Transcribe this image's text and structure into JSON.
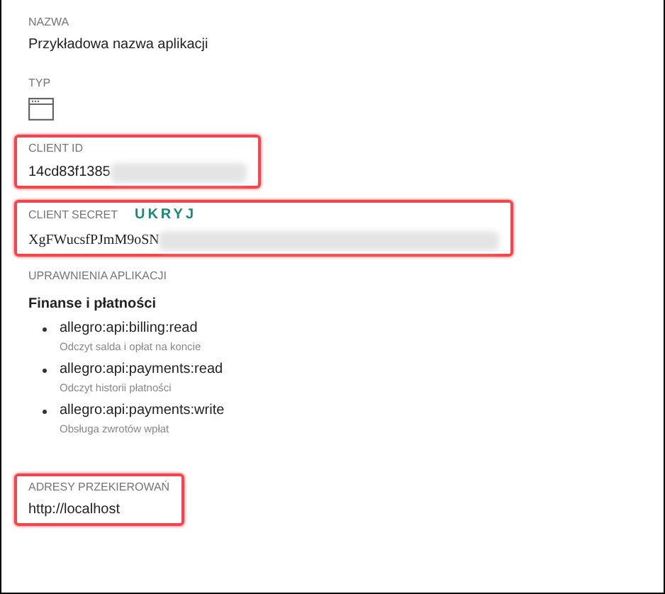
{
  "sections": [
    {
      "kind": "text",
      "label": "NAZWA",
      "value": "Przykładowa nazwa aplikacji",
      "highlighted": false
    },
    {
      "kind": "icon",
      "label": "TYP",
      "highlighted": false
    },
    {
      "kind": "secret",
      "label": "CLIENT ID",
      "value": "14cd83f1385",
      "highlighted": true
    },
    {
      "kind": "secret",
      "label": "CLIENT SECRET",
      "action": "UKRYJ",
      "value": "XgFWucsfPJmM9oSN",
      "highlighted": true
    },
    {
      "kind": "scopes",
      "label": "UPRAWNIENIA APLIKACJI",
      "group": "Finanse i płatności",
      "highlighted": false,
      "items": [
        {
          "scope": "allegro:api:billing:read",
          "description": "Odczyt salda i opłat na koncie"
        },
        {
          "scope": "allegro:api:payments:read",
          "description": "Odczyt historii płatności"
        },
        {
          "scope": "allegro:api:payments:write",
          "description": "Obsługa zwrotów wpłat"
        }
      ]
    },
    {
      "kind": "text",
      "label": "ADRESY PRZEKIEROWAŃ",
      "value": "http://localhost",
      "highlighted": true
    }
  ]
}
